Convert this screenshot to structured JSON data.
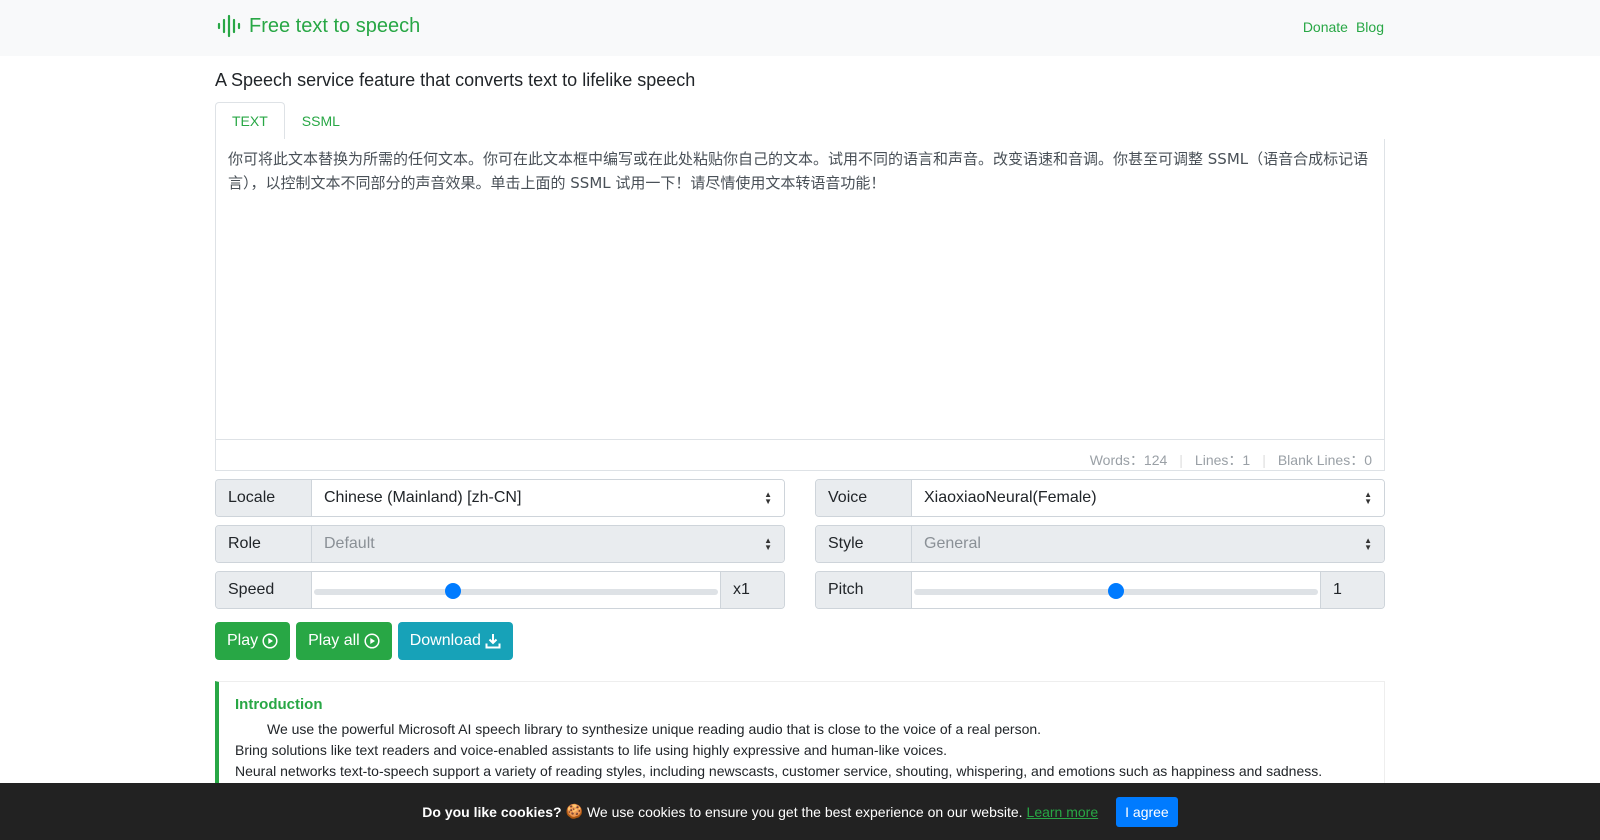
{
  "brand": {
    "name": "Free text to speech",
    "icon": "audio-wave-icon"
  },
  "nav": {
    "donate": "Donate",
    "blog": "Blog"
  },
  "heading": "A Speech service feature that converts text to lifelike speech",
  "tabs": [
    {
      "label": "TEXT",
      "active": true
    },
    {
      "label": "SSML",
      "active": false
    }
  ],
  "editor": {
    "text": "你可将此文本替换为所需的任何文本。你可在此文本框中编写或在此处粘贴你自己的文本。试用不同的语言和声音。改变语速和音调。你甚至可调整 SSML（语音合成标记语言），以控制文本不同部分的声音效果。单击上面的 SSML 试用一下！请尽情使用文本转语音功能！",
    "words": "Words：124",
    "lines": "Lines：1",
    "blank_lines": "Blank Lines：0"
  },
  "controls": {
    "locale": {
      "label": "Locale",
      "value": "Chinese (Mainland) [zh-CN]"
    },
    "voice": {
      "label": "Voice",
      "value": "XiaoxiaoNeural(Female)"
    },
    "role": {
      "label": "Role",
      "value": "Default"
    },
    "style": {
      "label": "Style",
      "value": "General"
    },
    "speed": {
      "label": "Speed",
      "value": "x1",
      "fraction": 0.34
    },
    "pitch": {
      "label": "Pitch",
      "value": "1",
      "fraction": 0.5
    }
  },
  "buttons": {
    "play": "Play",
    "play_all": "Play all",
    "download": "Download"
  },
  "intro": {
    "title": "Introduction",
    "lines": [
      "We use the powerful Microsoft AI speech library to synthesize unique reading audio that is close to the voice of a real person.",
      "Bring solutions like text readers and voice-enabled assistants to life using highly expressive and human-like voices.",
      "Neural networks text-to-speech support a variety of reading styles, including newscasts, customer service, shouting, whispering, and emotions such as happiness and sadness."
    ]
  },
  "cookie": {
    "question": "Do you like cookies?",
    "message": "We use cookies to ensure you get the best experience on our website.",
    "learn_more": "Learn more",
    "agree": "I agree"
  },
  "colors": {
    "accent": "#28a745",
    "primary": "#007bff",
    "info": "#17a2b8"
  }
}
